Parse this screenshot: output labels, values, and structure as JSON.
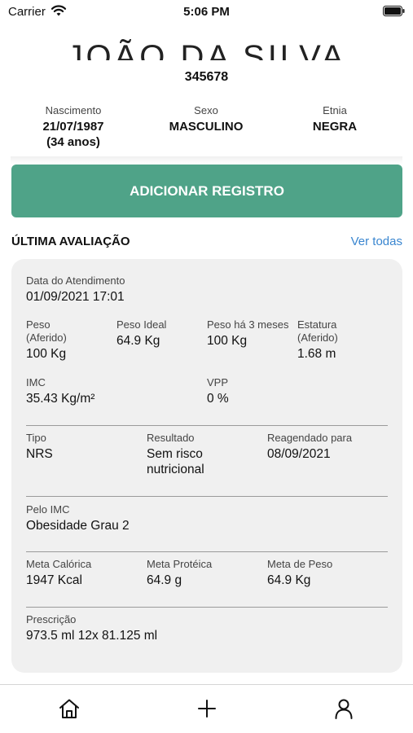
{
  "status_bar": {
    "carrier": "Carrier",
    "time": "5:06 PM"
  },
  "patient": {
    "name_partial": "JOÃO DA SILVA",
    "id": "345678",
    "birth_label": "Nascimento",
    "birth_date": "21/07/1987",
    "age": "(34 anos)",
    "sex_label": "Sexo",
    "sex": "MASCULINO",
    "ethnicity_label": "Etnia",
    "ethnicity": "NEGRA"
  },
  "add_button_label": "ADICIONAR REGISTRO",
  "section": {
    "title": "ÚLTIMA AVALIAÇÃO",
    "see_all": "Ver todas"
  },
  "evaluation": {
    "date": {
      "label": "Data do Atendimento",
      "value": "01/09/2021 17:01"
    },
    "weight": {
      "label": "Peso\n(Aferido)",
      "value": "100 Kg"
    },
    "ideal_weight": {
      "label": "Peso Ideal",
      "value": "64.9 Kg"
    },
    "weight_3m": {
      "label": "Peso há 3 meses",
      "value": "100 Kg"
    },
    "height": {
      "label": "Estatura\n(Aferido)",
      "value": "1.68 m"
    },
    "bmi": {
      "label": "IMC",
      "value": "35.43 Kg/m²"
    },
    "vpp": {
      "label": "VPP",
      "value": "0 %"
    },
    "type": {
      "label": "Tipo",
      "value": "NRS"
    },
    "result": {
      "label": "Resultado",
      "value": "Sem risco\nnutricional"
    },
    "rescheduled": {
      "label": "Reagendado para",
      "value": "08/09/2021"
    },
    "by_bmi": {
      "label": "Pelo IMC",
      "value": "Obesidade Grau 2"
    },
    "caloric_goal": {
      "label": "Meta Calórica",
      "value": "1947 Kcal"
    },
    "protein_goal": {
      "label": "Meta Protéica",
      "value": "64.9 g"
    },
    "weight_goal": {
      "label": "Meta de Peso",
      "value": "64.9 Kg"
    },
    "prescription": {
      "label": "Prescrição",
      "value": "973.5 ml 12x 81.125 ml"
    }
  },
  "tab_bar": {
    "icons": [
      "home-icon",
      "plus-icon",
      "user-icon"
    ]
  },
  "colors": {
    "accent": "#4fa388",
    "link": "#3a86d0",
    "card_bg": "#f0f0f0"
  }
}
